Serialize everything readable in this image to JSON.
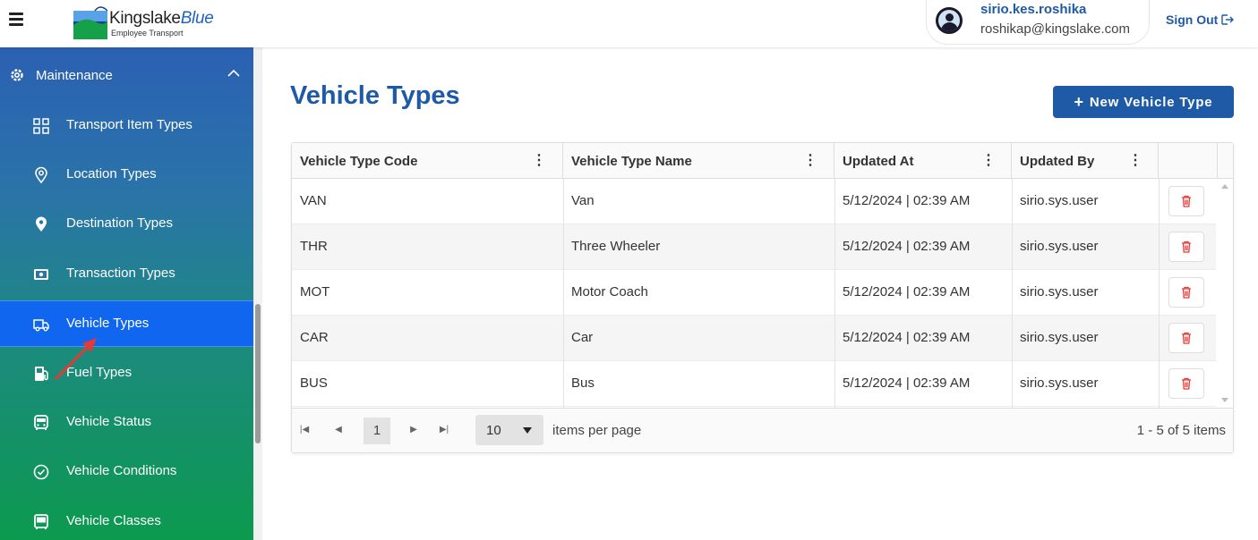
{
  "header": {
    "logo_name": "Kingslake",
    "logo_name_accent": "Blue",
    "logo_subtitle": "Employee Transport",
    "user_name": "sirio.kes.roshika",
    "user_email": "roshikap@kingslake.com",
    "signout_label": "Sign Out"
  },
  "sidebar": {
    "section_label": "Maintenance",
    "items": [
      {
        "label": "Transport Item Types",
        "icon": "grid-icon"
      },
      {
        "label": "Location Types",
        "icon": "location-pin-outline-icon"
      },
      {
        "label": "Destination Types",
        "icon": "location-pin-icon"
      },
      {
        "label": "Transaction Types",
        "icon": "cash-icon"
      },
      {
        "label": "Vehicle Types",
        "icon": "truck-icon",
        "active": true
      },
      {
        "label": "Fuel Types",
        "icon": "fuel-pump-icon"
      },
      {
        "label": "Vehicle Status",
        "icon": "bus-icon"
      },
      {
        "label": "Vehicle Conditions",
        "icon": "check-circle-icon"
      },
      {
        "label": "Vehicle Classes",
        "icon": "bus-front-icon"
      }
    ]
  },
  "main": {
    "title": "Vehicle Types",
    "new_button_label": "New Vehicle Type",
    "columns": [
      "Vehicle Type Code",
      "Vehicle Type Name",
      "Updated At",
      "Updated By"
    ],
    "rows": [
      {
        "code": "VAN",
        "name": "Van",
        "updated_at": "5/12/2024 | 02:39 AM",
        "updated_by": "sirio.sys.user"
      },
      {
        "code": "THR",
        "name": "Three Wheeler",
        "updated_at": "5/12/2024 | 02:39 AM",
        "updated_by": "sirio.sys.user"
      },
      {
        "code": "MOT",
        "name": "Motor Coach",
        "updated_at": "5/12/2024 | 02:39 AM",
        "updated_by": "sirio.sys.user"
      },
      {
        "code": "CAR",
        "name": "Car",
        "updated_at": "5/12/2024 | 02:39 AM",
        "updated_by": "sirio.sys.user"
      },
      {
        "code": "BUS",
        "name": "Bus",
        "updated_at": "5/12/2024 | 02:39 AM",
        "updated_by": "sirio.sys.user"
      }
    ],
    "pager": {
      "current_page": "1",
      "page_size": "10",
      "items_per_page_label": "items per page",
      "info": "1 - 5 of 5 items"
    }
  },
  "colors": {
    "primary": "#1f5aa6",
    "active_nav": "#1166f0",
    "delete_icon": "#e53935"
  }
}
